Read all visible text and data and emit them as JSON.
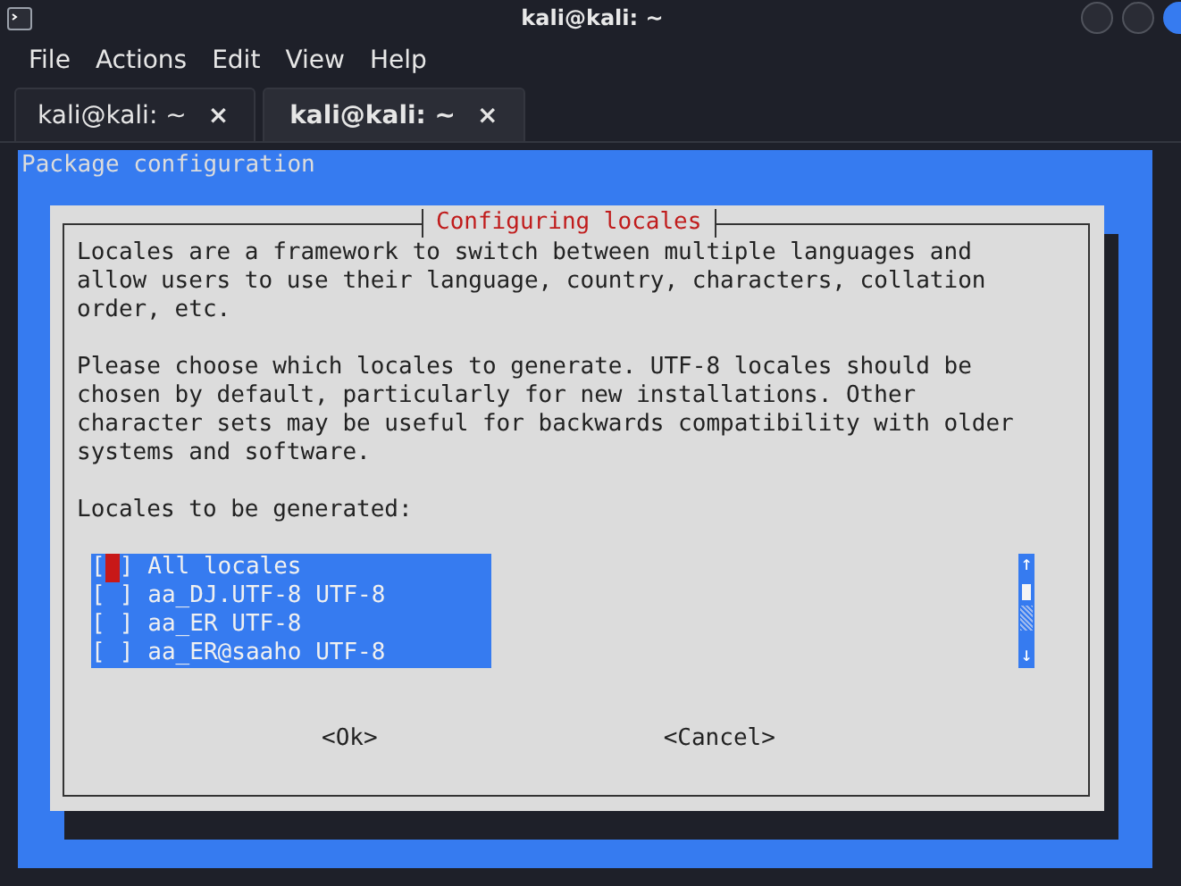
{
  "window": {
    "title": "kali@kali: ~"
  },
  "menu": [
    "File",
    "Actions",
    "Edit",
    "View",
    "Help"
  ],
  "tabs": [
    {
      "label": "kali@kali: ~",
      "close": "×",
      "selected": false
    },
    {
      "label": "kali@kali: ~",
      "close": "×",
      "selected": true
    }
  ],
  "terminal": {
    "header": "Package configuration"
  },
  "dialog": {
    "title": "Configuring locales",
    "paragraphs": [
      [
        "Locales are a framework to switch between multiple languages and",
        "allow users to use their language, country, characters, collation",
        "order, etc."
      ],
      [
        "Please choose which locales to generate. UTF-8 locales should be",
        "chosen by default, particularly for new installations. Other",
        "character sets may be useful for backwards compatibility with older",
        "systems and software."
      ]
    ],
    "prompt": "Locales to be generated:",
    "items": [
      {
        "box": "[ ]",
        "label": "All locales",
        "checked": false,
        "selected": true
      },
      {
        "box": "[ ]",
        "label": "aa_DJ.UTF-8 UTF-8",
        "checked": false,
        "selected": false
      },
      {
        "box": "[ ]",
        "label": "aa_ER UTF-8",
        "checked": false,
        "selected": false
      },
      {
        "box": "[ ]",
        "label": "aa_ER@saaho UTF-8",
        "checked": false,
        "selected": false
      }
    ],
    "scroll": {
      "up": "↑",
      "down": "↓"
    },
    "buttons": [
      "<Ok>",
      "<Cancel>"
    ]
  }
}
